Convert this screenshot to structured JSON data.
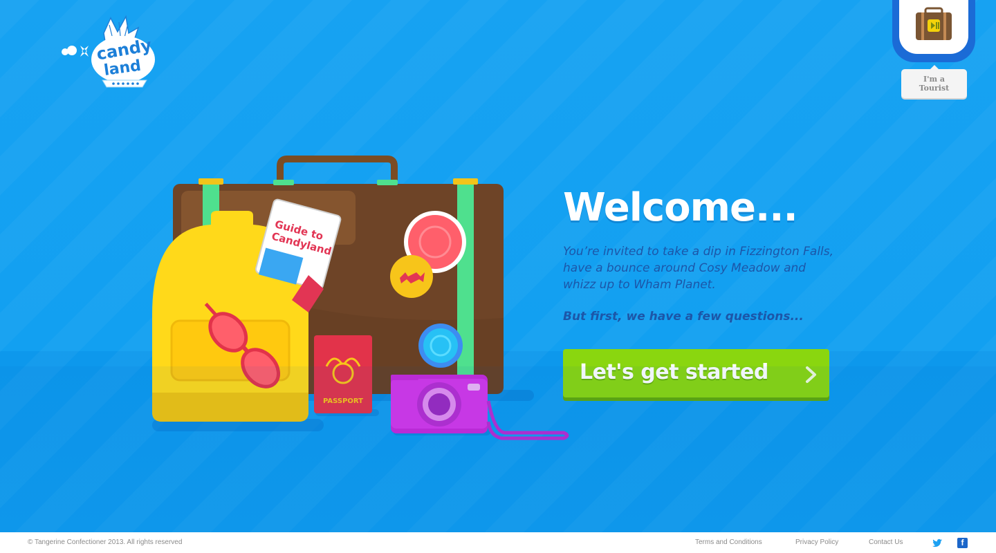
{
  "logo": {
    "text_line1": "candy",
    "text_line2": "land"
  },
  "tourist_toggle": {
    "line1": "I'm a",
    "line2": "Tourist"
  },
  "illustration": {
    "guide_text_line1": "Guide to",
    "guide_text_line2": "Candyland",
    "passport_text": "PASSPORT"
  },
  "hero": {
    "title": "Welcome...",
    "intro": "You’re invited to take a dip in Fizzington Falls, have a bounce around Cosy Meadow and whizz up to Wham Planet.",
    "questions": "But first, we have a few questions...",
    "cta_label": "Let's get started"
  },
  "footer": {
    "copyright": "© Tangerine Confectioner 2013. All rights reserved",
    "links": [
      "Terms and Conditions",
      "Privacy Policy",
      "Contact Us"
    ],
    "social": [
      "twitter-icon",
      "facebook-icon"
    ]
  },
  "colors": {
    "background": "#12a0f1",
    "cta": "#8ad60f",
    "intro_text": "#1c56a8",
    "tourist_ring": "#1b6bd6"
  }
}
